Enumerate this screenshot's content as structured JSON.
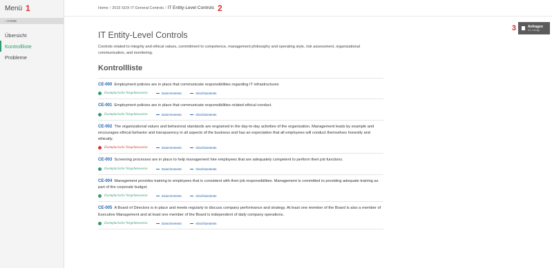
{
  "sidebar": {
    "menu_label": "Menü",
    "badge": "1",
    "home_label": "‹ HOME",
    "items": [
      {
        "label": "Übersicht"
      },
      {
        "label": "Kontrollliste"
      },
      {
        "label": "Probleme"
      }
    ]
  },
  "breadcrumb": {
    "home": "Home",
    "parent": "2015 SOX IT General Controls",
    "current": "IT Entity-Level Controls",
    "separator": "/",
    "badge": "2"
  },
  "action": {
    "badge": "3",
    "title": "Anfragen",
    "subtitle": "0/1 erledigt"
  },
  "page": {
    "title": "IT Entity-Level Controls",
    "description": "Controls related to integrity and ethical values, commitment to competence, management philosophy and operating style, risk assessment, organizational communication, and monitoring.",
    "section_title": "Kontrollliste"
  },
  "tag_labels": {
    "exemplary": "Exemplarische Vorgehensweise",
    "interim": "Zwischentests",
    "final": "Abschlusstests"
  },
  "controls": [
    {
      "id": "CE-000",
      "text": "Employment policies are in place that communicate responsibilities regarding IT infrastructures",
      "status": "ok"
    },
    {
      "id": "CE-001",
      "text": "Employment policies are in place that communicate responsibilities related ethical conduct.",
      "status": "ok"
    },
    {
      "id": "CE-002",
      "text": "The organizational values and behavioral standards are engrained in the day-to-day activities of the organization. Management leads by example and encourages ethical behavior and transparency in all aspects of the business and has an expectation that all employees will conduct themselves honestly and ethically.",
      "status": "err"
    },
    {
      "id": "CE-003",
      "text": "Screening processes are in place to help management hire employees that are adequately competent to perform their job functions.",
      "status": "ok"
    },
    {
      "id": "CE-004",
      "text": "Management provides training to employees that is consistent with their job responsibilities. Management is committed to providing adequate training as part of the corporate budget.",
      "status": "ok"
    },
    {
      "id": "CE-005",
      "text": "A Board of Directors is in place and meets regularly to discuss company performance and strategy. At least one member of the Board is also a member of Executive Management and at least one member of the Board is independent of daily company operations.",
      "status": "ok"
    }
  ]
}
